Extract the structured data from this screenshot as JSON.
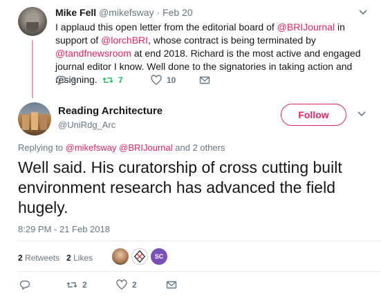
{
  "parent_tweet": {
    "name": "Mike Fell",
    "handle": "@mikefsway",
    "sep": "·",
    "date": "Feb 20",
    "text_segments": [
      {
        "t": "I applaud this open letter from the editorial board of ",
        "m": false
      },
      {
        "t": "@BRIJournal",
        "m": true
      },
      {
        "t": " in support of ",
        "m": false
      },
      {
        "t": "@lorchBRI",
        "m": true
      },
      {
        "t": ", whose contract is being terminated by ",
        "m": false
      },
      {
        "t": "@tandfnewsroom",
        "m": true
      },
      {
        "t": " at end 2018. Richard is the most active and engaged journal editor I know. Well done to the signatories in taking action and resigning.",
        "m": false
      }
    ],
    "replies": "3",
    "retweets": "7",
    "likes": "10"
  },
  "tweet": {
    "name": "Reading Architecture",
    "handle": "@UniRdg_Arc",
    "follow_label": "Follow",
    "replying_prefix": "Replying to ",
    "replying_mentions": "@mikefsway @BRIJournal",
    "replying_suffix": " and 2 others",
    "text": "Well said. His curatorship of cross cutting built environment research has advanced the field hugely.",
    "timestamp": "8:29 PM - 21 Feb 2018",
    "retweet_count": "2",
    "retweet_label": "Retweets",
    "like_count": "2",
    "like_label": "Likes",
    "replies": "",
    "retweets": "2",
    "likes": "2",
    "liker3_text": "SC"
  },
  "colors": {
    "accent": "#e0245e",
    "retweet_green": "#17bf63",
    "muted": "#657786",
    "thread_line": "#e0a4b7"
  }
}
